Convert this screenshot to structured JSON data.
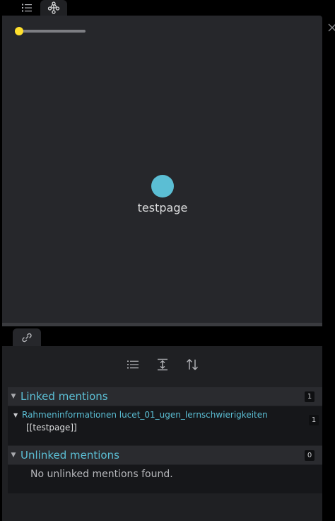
{
  "top_tabs": [
    {
      "name": "outline",
      "icon": "list-icon",
      "active": false
    },
    {
      "name": "graph",
      "icon": "graph-icon",
      "active": true
    }
  ],
  "graph": {
    "node_label": "testpage",
    "node_color": "#5bbed4",
    "slider_color": "#ffe02d",
    "slider_value": 0
  },
  "backlinks": {
    "tab_icon": "link-icon",
    "toolbar": [
      "list-icon",
      "expand-vertical-icon",
      "sort-icon"
    ],
    "linked": {
      "title": "Linked mentions",
      "count": "1",
      "results": [
        {
          "file": "Rahmeninformationen lucet_01_ugen_lernschwierigkeiten",
          "snippet": "[[testpage]]",
          "count": "1"
        }
      ]
    },
    "unlinked": {
      "title": "Unlinked mentions",
      "count": "0",
      "empty_text": "No unlinked mentions found."
    }
  },
  "accent_color": "#5bbed4"
}
